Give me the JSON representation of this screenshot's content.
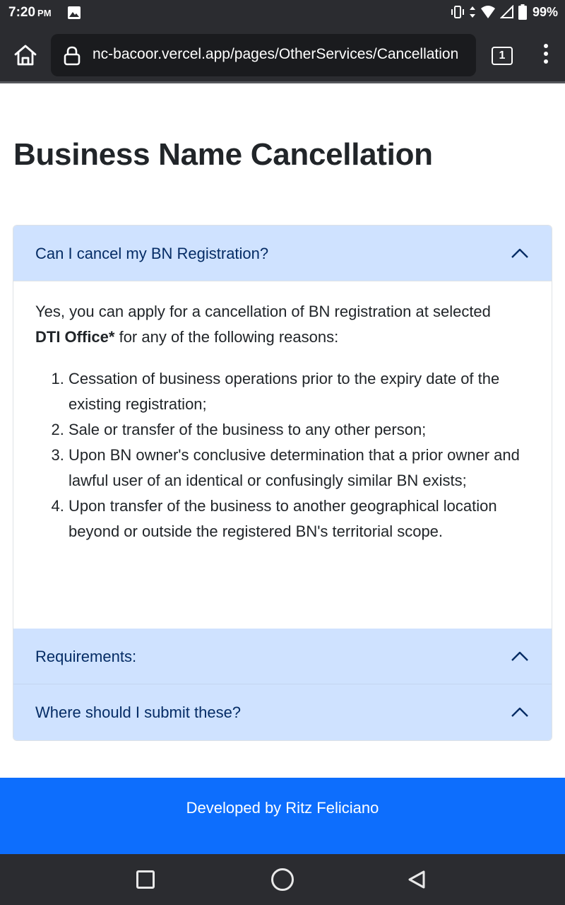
{
  "status_bar": {
    "time": "7:20",
    "ampm": "PM",
    "battery": "99%",
    "icons": [
      "gallery-icon",
      "vibrate-icon",
      "data-arrows-icon",
      "wifi-icon",
      "signal-icon",
      "battery-icon"
    ]
  },
  "browser": {
    "url": "nc-bacoor.vercel.app/pages/OtherServices/Cancellation",
    "tab_count": "1",
    "icons": [
      "home-icon",
      "lock-icon",
      "more-vert-icon"
    ]
  },
  "page": {
    "title": "Business Name Cancellation"
  },
  "accordion": {
    "items": [
      {
        "title": "Can I cancel my BN Registration?",
        "expanded": true,
        "intro_prefix": "Yes, you can apply for a cancellation of BN registration at selected ",
        "intro_bold": "DTI Office*",
        "intro_suffix": " for any of the following reasons:",
        "reasons": [
          "Cessation of business operations prior to the expiry date of the existing registration;",
          "Sale or transfer of the business to any other person;",
          "Upon BN owner's conclusive determination that a prior owner and lawful user of an identical or confusingly similar BN exists;",
          "Upon transfer of the business to another geographical location beyond or outside the registered BN's territorial scope."
        ]
      },
      {
        "title": "Requirements:",
        "expanded": false
      },
      {
        "title": "Where should I submit these?",
        "expanded": false
      }
    ]
  },
  "footer": {
    "text": "Developed by Ritz Feliciano"
  },
  "colors": {
    "accordion_header_bg": "#cfe2ff",
    "accordion_header_text": "#052c65",
    "footer_bg": "#0d6efd",
    "system_bar_bg": "#2b2c30"
  }
}
